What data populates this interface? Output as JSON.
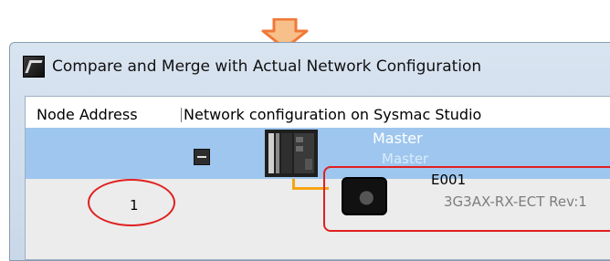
{
  "window": {
    "title": "Compare and Merge with Actual Network Configuration"
  },
  "table": {
    "columns": {
      "node_address": "Node Address",
      "network_configuration": "Network configuration on Sysmac Studio"
    },
    "master": {
      "name": "Master",
      "sub": "Master"
    },
    "slave": {
      "node_address": "1",
      "name": "E001",
      "model": "3G3AX-RX-ECT Rev:1"
    }
  },
  "colors": {
    "highlight_row": "#9ec6ee",
    "annotation_red": "#e02020",
    "arrow_orange": "#f07838",
    "connector": "#f6a512"
  },
  "icons": {
    "arrow": "down-arrow-icon",
    "app": "sysmac-app-icon",
    "collapse": "collapse-minus-icon",
    "master": "plc-controller-icon",
    "slave": "servo-drive-icon"
  }
}
